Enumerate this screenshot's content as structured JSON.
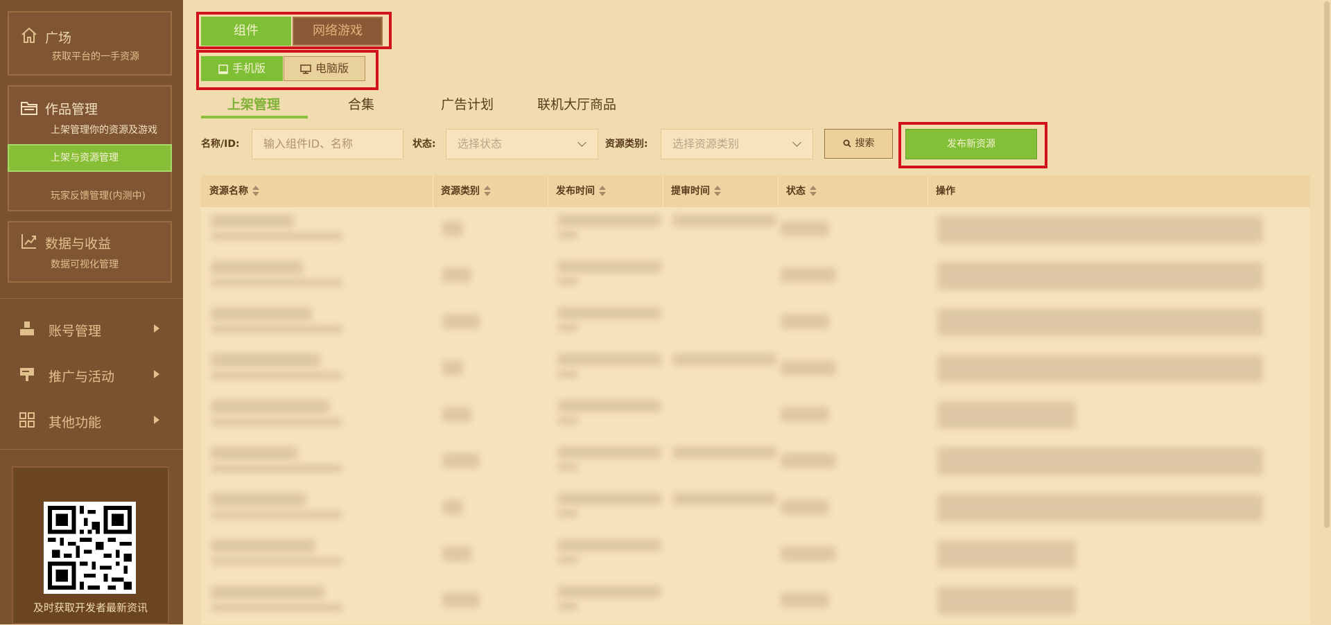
{
  "sidebar": {
    "plaza": {
      "title": "广场",
      "subtitle": "获取平台的一手资源"
    },
    "works": {
      "title": "作品管理",
      "subtitle": "上架管理你的资源及游戏",
      "items": [
        {
          "label": "上架与资源管理",
          "active": true
        },
        {
          "label": "玩家反馈管理(内测中)",
          "active": false
        }
      ]
    },
    "data": {
      "title": "数据与收益",
      "subtitle": "数据可视化管理"
    },
    "menu": [
      {
        "label": "账号管理",
        "icon": "account-icon"
      },
      {
        "label": "推广与活动",
        "icon": "promotion-icon"
      },
      {
        "label": "其他功能",
        "icon": "grid-icon"
      }
    ],
    "qr_caption": "及时获取开发者最新资讯"
  },
  "type_toggle": {
    "component": "组件",
    "netgame": "网络游戏",
    "selected": "component"
  },
  "platform_toggle": {
    "mobile": "手机版",
    "pc": "电脑版",
    "selected": "mobile"
  },
  "subtabs": [
    "上架管理",
    "合集",
    "广告计划",
    "联机大厅商品"
  ],
  "filters": {
    "name_label": "名称/ID:",
    "name_placeholder": "输入组件ID、名称",
    "status_label": "状态:",
    "status_placeholder": "选择状态",
    "category_label": "资源类别:",
    "category_placeholder": "选择资源类别",
    "search_button": "搜索",
    "publish_button": "发布新资源"
  },
  "table": {
    "columns": [
      "资源名称",
      "资源类别",
      "发布时间",
      "提审时间",
      "状态",
      "操作"
    ]
  },
  "colors": {
    "accent_green": "#82c037",
    "highlight_red": "#d0121a",
    "sidebar_brown": "#7a5230",
    "page_bg": "#f0dcae"
  }
}
